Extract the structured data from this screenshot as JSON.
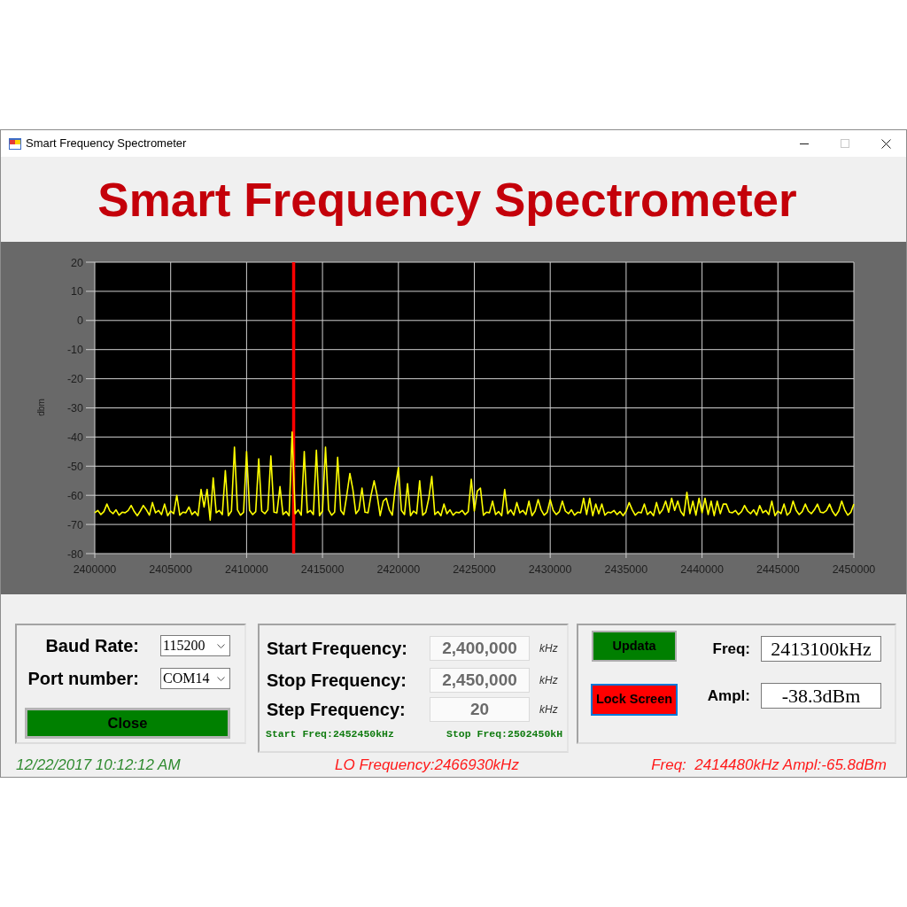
{
  "window": {
    "title": "Smart Frequency Spectrometer",
    "maximize_disabled": true
  },
  "header": {
    "title": "Smart Frequency Spectrometer"
  },
  "spectrum": {
    "chart_data": {
      "type": "line",
      "ylabel": "dbm",
      "x": [
        2400000,
        2400200,
        2400400,
        2400600,
        2400800,
        2401000,
        2401200,
        2401400,
        2401600,
        2401800,
        2402000,
        2402200,
        2402400,
        2402600,
        2402800,
        2403000,
        2403200,
        2403400,
        2403600,
        2403800,
        2404000,
        2404200,
        2404400,
        2404600,
        2404800,
        2405000,
        2405200,
        2405400,
        2405600,
        2405800,
        2406000,
        2406200,
        2406400,
        2406600,
        2406800,
        2407000,
        2407200,
        2407400,
        2407600,
        2407800,
        2408000,
        2408200,
        2408400,
        2408600,
        2408800,
        2409000,
        2409200,
        2409400,
        2409600,
        2409800,
        2410000,
        2410200,
        2410400,
        2410600,
        2410800,
        2411000,
        2411200,
        2411400,
        2411600,
        2411800,
        2412000,
        2412200,
        2412400,
        2412600,
        2412800,
        2413000,
        2413200,
        2413400,
        2413600,
        2413800,
        2414000,
        2414200,
        2414400,
        2414600,
        2414800,
        2415000,
        2415200,
        2415400,
        2415600,
        2415800,
        2416000,
        2416200,
        2416400,
        2416600,
        2416800,
        2417000,
        2417200,
        2417400,
        2417600,
        2417800,
        2418000,
        2418200,
        2418400,
        2418600,
        2418800,
        2419000,
        2419200,
        2419400,
        2419600,
        2419800,
        2420000,
        2420200,
        2420400,
        2420600,
        2420800,
        2421000,
        2421200,
        2421400,
        2421600,
        2421800,
        2422000,
        2422200,
        2422400,
        2422600,
        2422800,
        2423000,
        2423200,
        2423400,
        2423600,
        2423800,
        2424000,
        2424200,
        2424400,
        2424600,
        2424800,
        2425000,
        2425200,
        2425400,
        2425600,
        2425800,
        2426000,
        2426200,
        2426400,
        2426600,
        2426800,
        2427000,
        2427200,
        2427400,
        2427600,
        2427800,
        2428000,
        2428200,
        2428400,
        2428600,
        2428800,
        2429000,
        2429200,
        2429400,
        2429600,
        2429800,
        2430000,
        2430200,
        2430400,
        2430600,
        2430800,
        2431000,
        2431200,
        2431400,
        2431600,
        2431800,
        2432000,
        2432200,
        2432400,
        2432600,
        2432800,
        2433000,
        2433200,
        2433400,
        2433600,
        2433800,
        2434000,
        2434200,
        2434400,
        2434600,
        2434800,
        2435000,
        2435200,
        2435400,
        2435600,
        2435800,
        2436000,
        2436200,
        2436400,
        2436600,
        2436800,
        2437000,
        2437200,
        2437400,
        2437600,
        2437800,
        2438000,
        2438200,
        2438400,
        2438600,
        2438800,
        2439000,
        2439200,
        2439400,
        2439600,
        2439800,
        2440000,
        2440200,
        2440400,
        2440600,
        2440800,
        2441000,
        2441200,
        2441400,
        2441600,
        2441800,
        2442000,
        2442200,
        2442400,
        2442600,
        2442800,
        2443000,
        2443200,
        2443400,
        2443600,
        2443800,
        2444000,
        2444200,
        2444400,
        2444600,
        2444800,
        2445000,
        2445200,
        2445400,
        2445600,
        2445800,
        2446000,
        2446200,
        2446400,
        2446600,
        2446800,
        2447000,
        2447200,
        2447400,
        2447600,
        2447800,
        2448000,
        2448200,
        2448400,
        2448600,
        2448800,
        2449000,
        2449200,
        2449400,
        2449600,
        2449800,
        2450000
      ],
      "series": [
        {
          "color": "#ffff00",
          "values": [
            -66,
            -65.2,
            -66.6,
            -65.6,
            -63,
            -65.4,
            -66.3,
            -65,
            -66.8,
            -65.8,
            -66,
            -65.2,
            -63.5,
            -65.6,
            -67,
            -65.4,
            -63.5,
            -65,
            -66.8,
            -62.5,
            -66,
            -65.2,
            -66.6,
            -63,
            -67,
            -65.4,
            -66.3,
            -60,
            -66.8,
            -65.8,
            -66,
            -64,
            -66.6,
            -65.6,
            -67,
            -58,
            -64,
            -58,
            -68.5,
            -54,
            -66,
            -65.2,
            -66.6,
            -51.5,
            -67,
            -65.4,
            -43.5,
            -65,
            -66.8,
            -65.8,
            -45,
            -65.2,
            -66.6,
            -65.6,
            -47.5,
            -65.4,
            -66.3,
            -65,
            -46.5,
            -65.8,
            -66,
            -57,
            -66.6,
            -65.6,
            -67,
            -38.3,
            -66.3,
            -65,
            -66.8,
            -45,
            -66,
            -65.2,
            -66.6,
            -44.5,
            -67,
            -65.4,
            -43.5,
            -65,
            -66.8,
            -65.8,
            -47,
            -65.2,
            -66.6,
            -60,
            -52.5,
            -58,
            -66.3,
            -65,
            -57.5,
            -65.8,
            -66,
            -60,
            -55,
            -60,
            -67,
            -62,
            -61,
            -65,
            -66.8,
            -57,
            -50.5,
            -65.2,
            -66.6,
            -56,
            -67,
            -65.4,
            -66.3,
            -55,
            -66.8,
            -65.8,
            -61,
            -53.5,
            -66.6,
            -65.6,
            -67,
            -63,
            -66.3,
            -65,
            -66.8,
            -65.8,
            -66,
            -65.2,
            -66.6,
            -65.6,
            -54.5,
            -65.4,
            -58.5,
            -57.5,
            -66.8,
            -65.8,
            -66,
            -62,
            -66.6,
            -65.6,
            -67,
            -58,
            -66.3,
            -65,
            -66.8,
            -62.5,
            -66,
            -65.2,
            -66.6,
            -62,
            -67,
            -65.4,
            -61.5,
            -65,
            -66.8,
            -65.8,
            -61.5,
            -65.2,
            -66.6,
            -65.6,
            -62,
            -65.4,
            -66.3,
            -65,
            -66.8,
            -65.8,
            -66,
            -61,
            -66.6,
            -61,
            -67,
            -63,
            -66.3,
            -63,
            -66.8,
            -65.8,
            -66,
            -65.2,
            -66.6,
            -65.6,
            -67,
            -65.4,
            -62.5,
            -65,
            -66.8,
            -65.8,
            -66,
            -63,
            -66.6,
            -65.6,
            -67,
            -62.5,
            -66.3,
            -65,
            -62,
            -65.8,
            -61,
            -65.2,
            -62,
            -65.6,
            -67,
            -59,
            -66.3,
            -62,
            -66.8,
            -61,
            -66,
            -61,
            -66.6,
            -62,
            -67,
            -62,
            -66.3,
            -63,
            -63,
            -65.8,
            -66,
            -65.2,
            -66.6,
            -65.6,
            -63.5,
            -65.4,
            -66.3,
            -65,
            -66.8,
            -63.5,
            -66,
            -65.2,
            -66.6,
            -62,
            -67,
            -65.4,
            -66.3,
            -63,
            -66.8,
            -65.8,
            -62,
            -65.2,
            -66.6,
            -65.6,
            -63,
            -65.4,
            -66.3,
            -65,
            -63,
            -65.8,
            -66,
            -65.2,
            -63,
            -65.6,
            -67,
            -65.4,
            -62,
            -65,
            -66.8,
            -65.8,
            -63
          ]
        }
      ],
      "xlim": [
        2400000,
        2450000
      ],
      "ylim": [
        -80,
        20
      ],
      "xticks": [
        2400000,
        2405000,
        2410000,
        2415000,
        2420000,
        2425000,
        2430000,
        2435000,
        2440000,
        2445000,
        2450000
      ],
      "yticks": [
        20,
        10,
        0,
        -10,
        -20,
        -30,
        -40,
        -50,
        -60,
        -70,
        -80
      ],
      "grid": true,
      "ref_lines": [
        {
          "axis": "x",
          "value": 2413100,
          "color": "#ff0000"
        }
      ]
    }
  },
  "connection": {
    "fields": [
      {
        "label": "Baud Rate:",
        "value": "115200"
      },
      {
        "label": "Port number:",
        "value": "COM14"
      }
    ],
    "button": {
      "label": "Close"
    }
  },
  "sweep": {
    "fields": [
      {
        "label": "Start Frequency:",
        "value": "2,400,000",
        "unit": "kHz"
      },
      {
        "label": "Stop Frequency:",
        "value": "2,450,000",
        "unit": "kHz"
      },
      {
        "label": "Step Frequency:",
        "value": "20",
        "unit": "kHz"
      }
    ],
    "start_note": "Start Freq:2452450kHz",
    "stop_note": "Stop Freq:2502450kH"
  },
  "marker": {
    "buttons": [
      {
        "label": "Updata",
        "color": "#007f00",
        "focused": false
      },
      {
        "label": "Lock Screen",
        "color": "#ff0000",
        "focused": true
      }
    ],
    "readouts": [
      {
        "label": "Freq:",
        "value": "2413100kHz"
      },
      {
        "label": "Ampl:",
        "value": "-38.3dBm"
      }
    ]
  },
  "status_bar": {
    "datetime": "12/22/2017 10:12:12 AM",
    "lo_frequency": "LO Frequency:2466930kHz",
    "reading": "Freq:  2414480kHz Ampl:-65.8dBm"
  }
}
